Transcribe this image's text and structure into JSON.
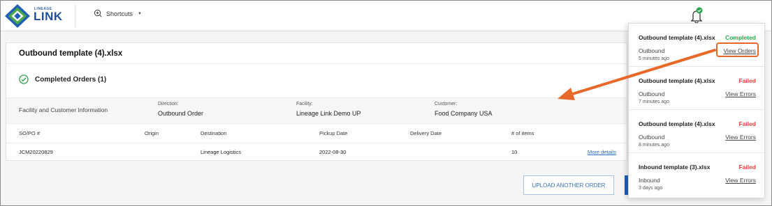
{
  "app": {
    "logo_small": "LINEAGE",
    "logo_main": "LINK",
    "shortcuts_label": "Shortcuts"
  },
  "colors": {
    "completed": "#2aa747",
    "failed": "#e8413c",
    "link": "#2a6bc4",
    "highlight": "#e8682a"
  },
  "card": {
    "title": "Outbound template (4).xlsx",
    "completed_label": "Completed Orders (1)",
    "info_title": "Facility and Customer Information",
    "direction_label": "Direction:",
    "direction_value": "Outbound Order",
    "facility_label": "Facility:",
    "facility_value": "Lineage Link Demo UP",
    "customer_label": "Customer:",
    "customer_value": "Food Company USA"
  },
  "table": {
    "headers": [
      "SO/PO #",
      "Origin",
      "Destination",
      "Pickup Date",
      "Delivery Date",
      "# of items"
    ],
    "rows": [
      {
        "so_po": "JCM20220829",
        "origin": "",
        "destination": "Lineage Logistics",
        "pickup": "2022-08-30",
        "delivery": "",
        "items": "10",
        "more": "More details"
      }
    ]
  },
  "upload_label": "UPLOAD ANOTHER ORDER",
  "notifications": [
    {
      "file": "Outbound template (4).xlsx",
      "status": "Completed",
      "direction": "Outbound",
      "time": "5 minutes ago",
      "action": "View Orders"
    },
    {
      "file": "Outbound template (4).xlsx",
      "status": "Failed",
      "direction": "Outbound",
      "time": "7 minutes ago",
      "action": "View Errors"
    },
    {
      "file": "Outbound template (4).xlsx",
      "status": "Failed",
      "direction": "Outbound",
      "time": "8 minutes ago",
      "action": "View Errors"
    },
    {
      "file": "Inbound template (3).xlsx",
      "status": "Failed",
      "direction": "Inbound",
      "time": "3 days ago",
      "action": "View Errors"
    }
  ]
}
